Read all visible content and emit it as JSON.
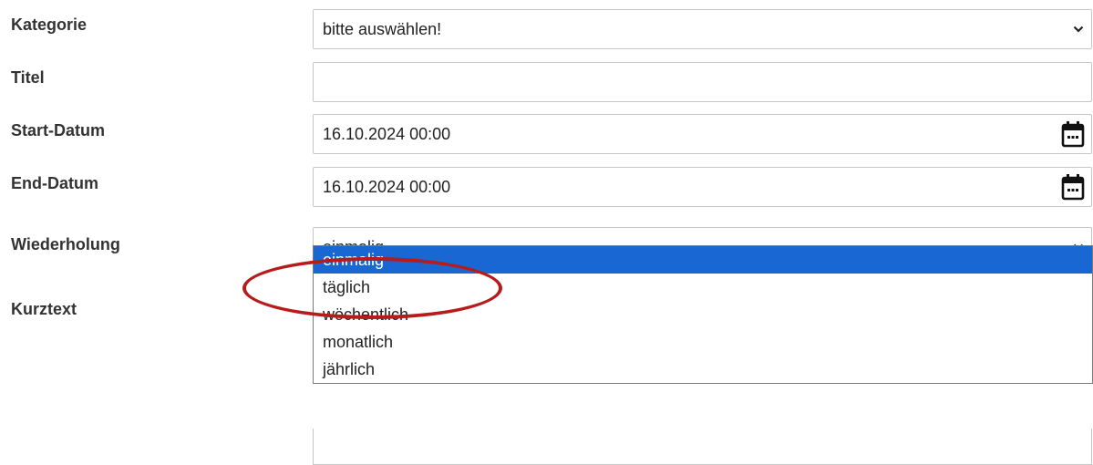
{
  "form": {
    "kategorie": {
      "label": "Kategorie",
      "value": "bitte auswählen!"
    },
    "titel": {
      "label": "Titel",
      "value": ""
    },
    "start_datum": {
      "label": "Start-Datum",
      "value": "16.10.2024 00:00"
    },
    "end_datum": {
      "label": "End-Datum",
      "value": "16.10.2024 00:00"
    },
    "wiederholung": {
      "label": "Wiederholung",
      "value": "einmalig",
      "options": [
        "einmalig",
        "täglich",
        "wöchentlich",
        "monatlich",
        "jährlich"
      ],
      "selected_index": 0
    },
    "kurztext": {
      "label": "Kurztext"
    }
  },
  "icons": {
    "select_chevron": "chevron-down-icon",
    "date_picker": "calendar-icon"
  },
  "colors": {
    "selected_option_bg": "#1967d2",
    "annotation": "#b71c1c"
  }
}
